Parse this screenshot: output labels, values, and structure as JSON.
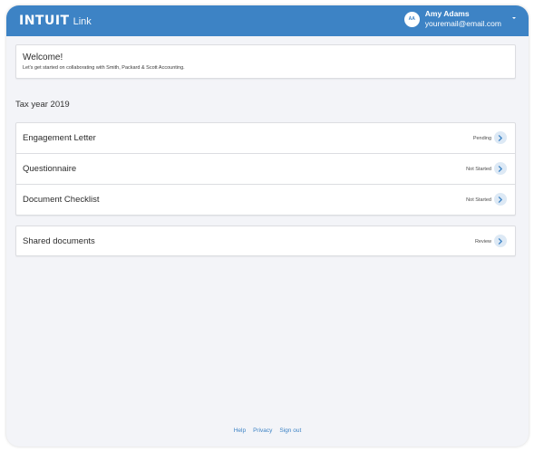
{
  "header": {
    "brand": "INTUIT",
    "product": "Link",
    "user": {
      "initials": "AA",
      "name": "Amy Adams",
      "email": "youremail@email.com"
    }
  },
  "welcome": {
    "title": "Welcome!",
    "subtitle": "Let's get started on collaborating with  Smith, Packard & Scott Accounting."
  },
  "section_title": "Tax year 2019",
  "tasks": [
    {
      "label": "Engagement Letter",
      "status": "Pending"
    },
    {
      "label": "Questionnaire",
      "status": "Not Started"
    },
    {
      "label": "Document Checklist",
      "status": "Not Started"
    }
  ],
  "shared": {
    "label": "Shared documents",
    "status": "Review"
  },
  "footer": {
    "links": [
      "Help",
      "Privacy",
      "Sign out"
    ]
  },
  "colors": {
    "brand_blue": "#3d83c5",
    "background": "#f3f4f8",
    "chevron_bg": "#dde9f5"
  }
}
